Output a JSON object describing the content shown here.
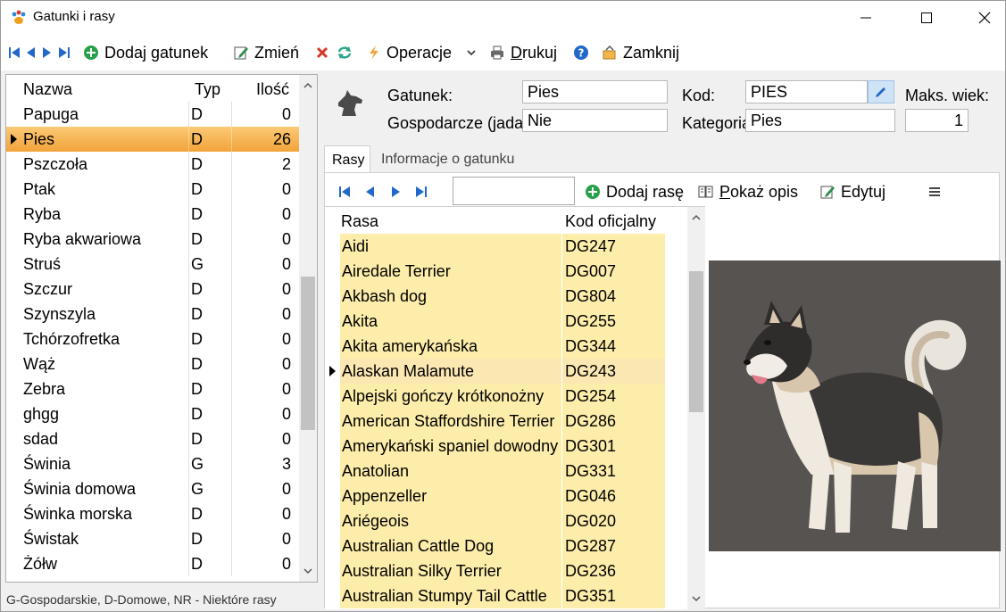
{
  "window": {
    "title": "Gatunki i rasy"
  },
  "toolbar": {
    "add_species": "Dodaj gatunek",
    "edit": "Zmień",
    "operations": "Operacje",
    "print": "Drukuj",
    "close": "Zamknij"
  },
  "species_list": {
    "columns": [
      "Nazwa",
      "Typ",
      "Ilość"
    ],
    "rows": [
      {
        "name": "Papuga",
        "type": "D",
        "count": "0"
      },
      {
        "name": "Pies",
        "type": "D",
        "count": "26"
      },
      {
        "name": "Pszczoła",
        "type": "D",
        "count": "2"
      },
      {
        "name": "Ptak",
        "type": "D",
        "count": "0"
      },
      {
        "name": "Ryba",
        "type": "D",
        "count": "0"
      },
      {
        "name": "Ryba akwariowa",
        "type": "D",
        "count": "0"
      },
      {
        "name": "Struś",
        "type": "G",
        "count": "0"
      },
      {
        "name": "Szczur",
        "type": "D",
        "count": "0"
      },
      {
        "name": "Szynszyla",
        "type": "D",
        "count": "0"
      },
      {
        "name": "Tchórzofretka",
        "type": "D",
        "count": "0"
      },
      {
        "name": "Wąż",
        "type": "D",
        "count": "0"
      },
      {
        "name": "Zebra",
        "type": "D",
        "count": "0"
      },
      {
        "name": "ghgg",
        "type": "D",
        "count": "0"
      },
      {
        "name": "sdad",
        "type": "D",
        "count": "0"
      },
      {
        "name": "Świnia",
        "type": "G",
        "count": "3"
      },
      {
        "name": "Świnia domowa",
        "type": "G",
        "count": "0"
      },
      {
        "name": "Świnka morska",
        "type": "D",
        "count": "0"
      },
      {
        "name": "Świstak",
        "type": "D",
        "count": "0"
      },
      {
        "name": "Żółw",
        "type": "D",
        "count": "0"
      }
    ],
    "legend": "G-Gospodarskie, D-Domowe, NR - Niektóre rasy"
  },
  "form": {
    "species_label": "Gatunek:",
    "species_value": "Pies",
    "code_label": "Kod:",
    "code_value": "PIES",
    "max_age_label": "Maks. wiek:",
    "max_age_value": "1",
    "farm_label": "Gospodarcze (jadalne):",
    "farm_value": "Nie",
    "category_label": "Kategoria:",
    "category_value": "Pies"
  },
  "tabs": {
    "breeds": "Rasy",
    "info": "Informacje o gatunku"
  },
  "breeds_toolbar": {
    "add_breed": "Dodaj rasę",
    "show_desc": "Pokaż opis",
    "edit": "Edytuj",
    "search_value": ""
  },
  "breeds": {
    "columns": [
      "Rasa",
      "Kod oficjalny"
    ],
    "rows": [
      {
        "name": "Aidi",
        "code": "DG247"
      },
      {
        "name": "Airedale Terrier",
        "code": "DG007"
      },
      {
        "name": "Akbash dog",
        "code": "DG804"
      },
      {
        "name": "Akita",
        "code": "DG255"
      },
      {
        "name": "Akita amerykańska",
        "code": "DG344"
      },
      {
        "name": "Alaskan Malamute",
        "code": "DG243"
      },
      {
        "name": "Alpejski gończy krótkonożny",
        "code": "DG254"
      },
      {
        "name": "American Staffordshire Terrier",
        "code": "DG286"
      },
      {
        "name": "Amerykański spaniel dowodny",
        "code": "DG301"
      },
      {
        "name": "Anatolian",
        "code": "DG331"
      },
      {
        "name": "Appenzeller",
        "code": "DG046"
      },
      {
        "name": "Ariégeois",
        "code": "DG020"
      },
      {
        "name": "Australian Cattle Dog",
        "code": "DG287"
      },
      {
        "name": "Australian Silky Terrier",
        "code": "DG236"
      },
      {
        "name": "Australian Stumpy Tail Cattle",
        "code": "DG351"
      }
    ]
  },
  "colors": {
    "selection": "#f2a33a",
    "breed_cell": "#fdedaa",
    "image_bg": "#575350"
  }
}
